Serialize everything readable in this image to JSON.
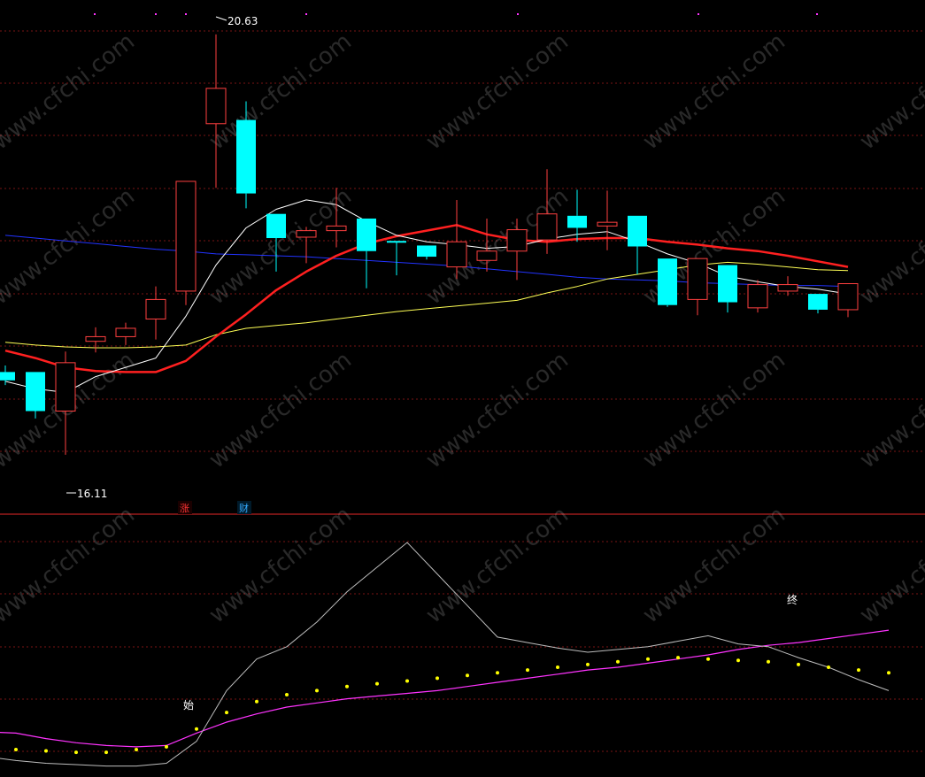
{
  "watermark": "www.cfchi.com",
  "colors": {
    "background": "#000000",
    "grid": "#7a1414",
    "divider": "#9a1a1a",
    "up_candle": "#ff4040",
    "down_candle": "#00ffff",
    "cross_candle": "#00ffff",
    "ma_short": "#ffffff",
    "ma_mid": "#ff2020",
    "ma_long1": "#ffff55",
    "ma_long2": "#2233ff",
    "osc_line": "#bdbdbd",
    "osc_signal": "#ff33ff",
    "osc_dots": "#ffff00",
    "badge_up": "#ff3333",
    "badge_fin": "#33aaff",
    "top_dots": "#ff33ff"
  },
  "annotations": {
    "high_label": "20.63",
    "low_label": "16.11",
    "badge_up": "涨",
    "badge_fin": "财",
    "start_marker": "始",
    "end_marker": "终"
  },
  "chart_data": [
    {
      "type": "candlestick",
      "price_range": [
        15.5,
        21.0
      ],
      "grid": true,
      "markers": {
        "high": 20.63,
        "low": 16.11
      },
      "candles": [
        {
          "o": 17.0,
          "h": 17.07,
          "c": 16.91,
          "l": 16.86
        },
        {
          "o": 17.0,
          "h": 17.0,
          "c": 16.58,
          "l": 16.5
        },
        {
          "o": 16.58,
          "h": 17.22,
          "c": 17.1,
          "l": 16.11
        },
        {
          "o": 17.33,
          "h": 17.48,
          "c": 17.38,
          "l": 17.21
        },
        {
          "o": 17.38,
          "h": 17.53,
          "c": 17.47,
          "l": 17.29
        },
        {
          "o": 17.57,
          "h": 17.92,
          "c": 17.78,
          "l": 17.35
        },
        {
          "o": 17.87,
          "h": 18.62,
          "c": 19.05,
          "l": 17.72
        },
        {
          "o": 19.67,
          "h": 20.63,
          "c": 20.05,
          "l": 18.98
        },
        {
          "o": 19.71,
          "h": 19.91,
          "c": 18.92,
          "l": 18.76
        },
        {
          "o": 18.7,
          "h": 18.7,
          "c": 18.44,
          "l": 18.08
        },
        {
          "o": 18.45,
          "h": 18.56,
          "c": 18.52,
          "l": 18.17
        },
        {
          "o": 18.52,
          "h": 18.98,
          "c": 18.57,
          "l": 18.34
        },
        {
          "o": 18.65,
          "h": 18.65,
          "c": 18.3,
          "l": 17.9
        },
        {
          "o": 18.4,
          "h": 18.4,
          "c": 18.4,
          "l": 18.04
        },
        {
          "o": 18.36,
          "h": 18.36,
          "c": 18.24,
          "l": 18.21
        },
        {
          "o": 18.13,
          "h": 18.85,
          "c": 18.4,
          "l": 18.0
        },
        {
          "o": 18.2,
          "h": 18.65,
          "c": 18.3,
          "l": 18.08
        },
        {
          "o": 18.3,
          "h": 18.65,
          "c": 18.53,
          "l": 17.99
        },
        {
          "o": 18.42,
          "h": 19.18,
          "c": 18.7,
          "l": 18.27
        },
        {
          "o": 18.68,
          "h": 18.96,
          "c": 18.55,
          "l": 18.4
        },
        {
          "o": 18.57,
          "h": 18.95,
          "c": 18.61,
          "l": 18.31
        },
        {
          "o": 18.68,
          "h": 18.68,
          "c": 18.35,
          "l": 18.05
        },
        {
          "o": 18.22,
          "h": 18.22,
          "c": 17.72,
          "l": 17.7
        },
        {
          "o": 17.78,
          "h": 18.21,
          "c": 18.22,
          "l": 17.61
        },
        {
          "o": 18.15,
          "h": 18.15,
          "c": 17.75,
          "l": 17.64
        },
        {
          "o": 17.69,
          "h": 17.99,
          "c": 17.94,
          "l": 17.64
        },
        {
          "o": 17.87,
          "h": 18.03,
          "c": 17.94,
          "l": 17.82
        },
        {
          "o": 17.84,
          "h": 17.84,
          "c": 17.67,
          "l": 17.63
        },
        {
          "o": 17.67,
          "h": 17.7,
          "c": 17.95,
          "l": 17.59
        }
      ],
      "ma_short": [
        16.9,
        16.82,
        16.78,
        16.95,
        17.05,
        17.15,
        17.6,
        18.15,
        18.55,
        18.75,
        18.85,
        18.8,
        18.62,
        18.47,
        18.4,
        18.37,
        18.33,
        18.35,
        18.43,
        18.48,
        18.51,
        18.4,
        18.27,
        18.17,
        18.03,
        17.97,
        17.92,
        17.89,
        17.84
      ],
      "ma_mid": [
        17.23,
        17.15,
        17.05,
        17.01,
        17.0,
        17.0,
        17.12,
        17.38,
        17.62,
        17.88,
        18.08,
        18.25,
        18.38,
        18.46,
        18.52,
        18.58,
        18.48,
        18.42,
        18.4,
        18.43,
        18.44,
        18.44,
        18.4,
        18.37,
        18.33,
        18.3,
        18.25,
        18.19,
        18.13
      ],
      "ma_long1": [
        17.32,
        17.29,
        17.27,
        17.26,
        17.26,
        17.27,
        17.29,
        17.4,
        17.47,
        17.5,
        17.53,
        17.57,
        17.61,
        17.65,
        17.68,
        17.71,
        17.74,
        17.77,
        17.85,
        17.92,
        18.0,
        18.05,
        18.1,
        18.15,
        18.18,
        18.16,
        18.13,
        18.1,
        18.09
      ],
      "ma_long2": [
        18.47,
        18.44,
        18.41,
        18.38,
        18.35,
        18.32,
        18.3,
        18.27,
        18.26,
        18.25,
        18.24,
        18.22,
        18.2,
        18.18,
        18.16,
        18.14,
        18.11,
        18.08,
        18.05,
        18.02,
        18.0,
        17.99,
        17.98,
        17.96,
        17.95,
        17.94,
        17.93,
        17.93,
        17.92
      ]
    },
    {
      "type": "line",
      "range": [
        0,
        100
      ],
      "grid": true,
      "series": [
        {
          "values": [
            15,
            12,
            10,
            9,
            8,
            8,
            10,
            26,
            63,
            86,
            95,
            113,
            135,
            153,
            171,
            148,
            125,
            102,
            98,
            94,
            91,
            93,
            95,
            99,
            103,
            97,
            95,
            87,
            80,
            71,
            63
          ]
        },
        {
          "values": [
            33,
            32,
            28,
            25,
            23,
            22,
            23,
            32,
            40,
            46,
            51,
            54,
            57,
            59,
            61,
            63,
            66,
            69,
            72,
            75,
            78,
            80,
            83,
            86,
            89,
            93,
            96,
            98,
            101,
            104,
            107
          ]
        },
        {
          "values": [
            22,
            20,
            19,
            18,
            18,
            20,
            22,
            35,
            47,
            55,
            60,
            63,
            66,
            68,
            70,
            72,
            74,
            76,
            78,
            80,
            82,
            84,
            86,
            87,
            86,
            85,
            84,
            82,
            80,
            78,
            76
          ]
        }
      ],
      "markers": {
        "start_index": 6,
        "end_index": 26
      }
    }
  ]
}
